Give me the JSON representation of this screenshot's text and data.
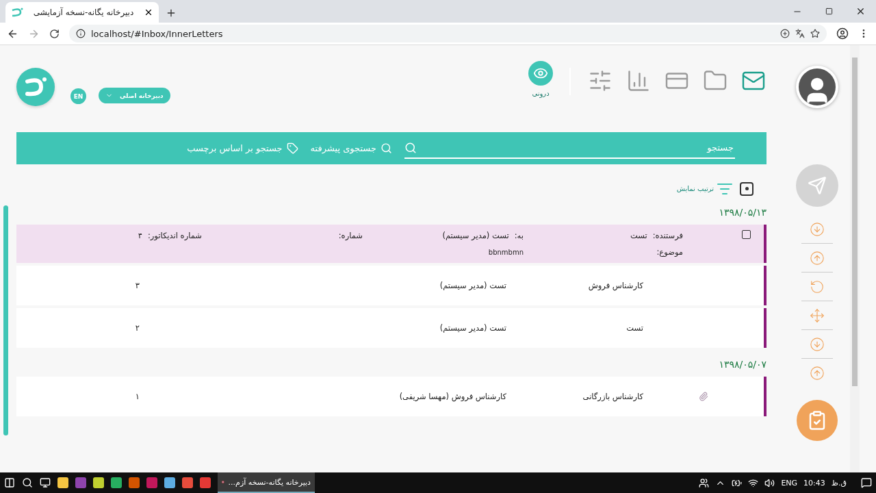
{
  "browser": {
    "tab_title": "دبیرخانه یگانه-نسخه آزمایشی",
    "url": "localhost/#Inbox/InnerLetters",
    "forward_enabled": false
  },
  "header": {
    "language": "EN",
    "secretariat": "دبیرخانه اصلی",
    "nav": [
      {
        "kind": "mail",
        "selected": true
      },
      {
        "kind": "folder",
        "selected": false
      },
      {
        "kind": "card",
        "selected": false
      },
      {
        "kind": "chart",
        "selected": false
      },
      {
        "kind": "filters",
        "selected": false
      }
    ],
    "view": {
      "label": "درونی",
      "selected": true
    }
  },
  "search": {
    "placeholder": "جستجو",
    "advanced": "جستجوی پیشرفته",
    "by_tag": "جستجو بر اساس برچسب"
  },
  "sort": {
    "label": "ترتیب نمایش"
  },
  "groups": [
    {
      "date": "۱۳۹۸/۰۵/۱۳",
      "letters": [
        {
          "expanded": true,
          "checked": false,
          "sender_label": "فرستنده:",
          "sender": "تست",
          "recipient_label": "به:",
          "recipient": "تست (مدیر سیستم)",
          "subject_label": "موضوع:",
          "subject": "bbnmbmn",
          "number_label": "شماره:",
          "indicator_label": "شماره اندیکاتور:",
          "indicator": "۴"
        },
        {
          "expanded": false,
          "attachment": false,
          "sender": "کارشناس فروش",
          "recipient": "تست (مدیر سیستم)",
          "indicator": "۳"
        },
        {
          "expanded": false,
          "attachment": false,
          "sender": "تست",
          "recipient": "تست (مدیر سیستم)",
          "indicator": "۲"
        }
      ]
    },
    {
      "date": "۱۳۹۸/۰۵/۰۷",
      "letters": [
        {
          "expanded": false,
          "attachment": true,
          "sender": "کارشناس بازرگانی",
          "recipient": "کارشناس فروش (مهسا شریفی)",
          "indicator": "۱"
        }
      ]
    }
  ],
  "rail": {
    "actions": [
      {
        "kind": "download"
      },
      {
        "kind": "upload"
      },
      {
        "kind": "undo"
      },
      {
        "kind": "move"
      },
      {
        "kind": "download"
      },
      {
        "kind": "upload"
      }
    ]
  },
  "taskbar": {
    "active_task": "دبیرخانه یگانه-نسخه آزم...",
    "language": "ENG",
    "time": "10:43",
    "period": "ق.ظ"
  }
}
